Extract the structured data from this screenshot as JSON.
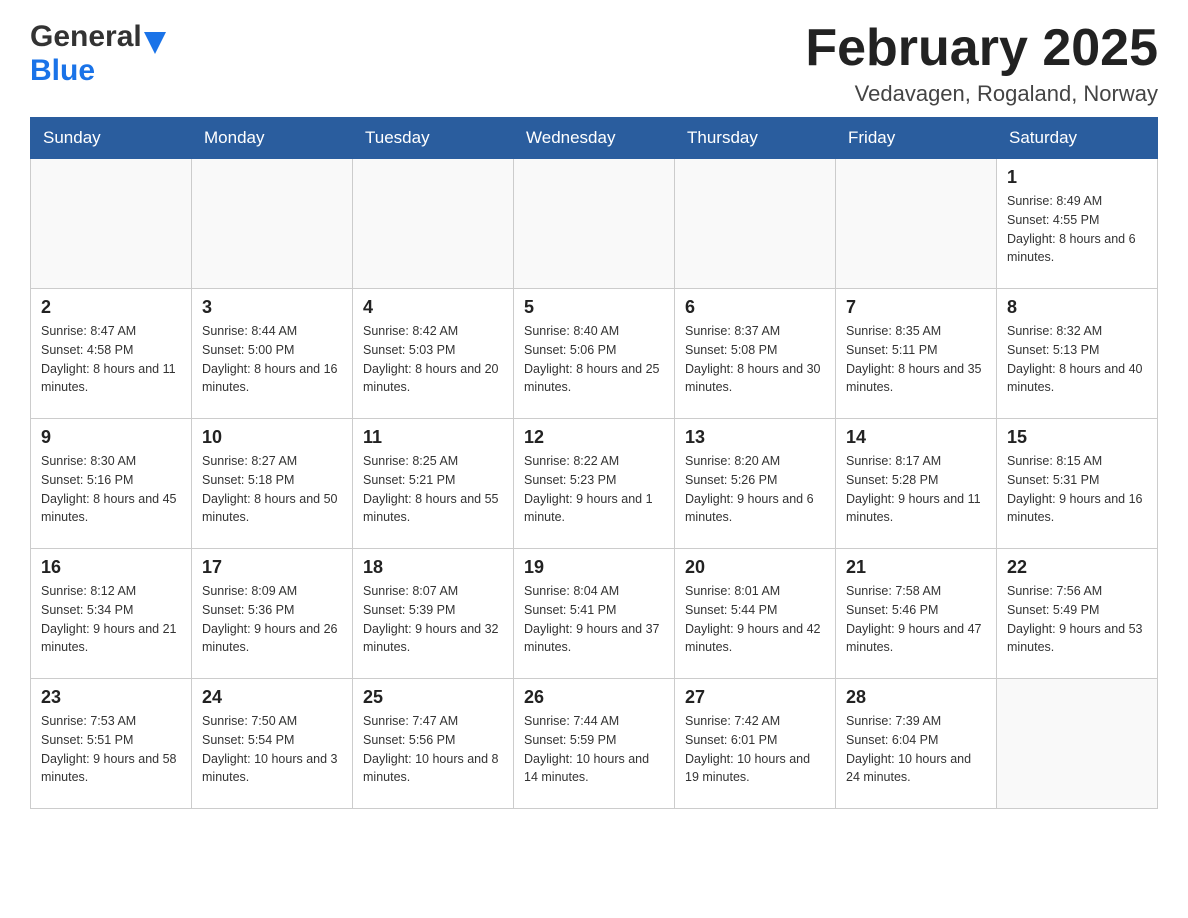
{
  "header": {
    "logo_general": "General",
    "logo_blue": "Blue",
    "month_year": "February 2025",
    "location": "Vedavagen, Rogaland, Norway"
  },
  "weekdays": [
    "Sunday",
    "Monday",
    "Tuesday",
    "Wednesday",
    "Thursday",
    "Friday",
    "Saturday"
  ],
  "weeks": [
    [
      {
        "day": "",
        "info": ""
      },
      {
        "day": "",
        "info": ""
      },
      {
        "day": "",
        "info": ""
      },
      {
        "day": "",
        "info": ""
      },
      {
        "day": "",
        "info": ""
      },
      {
        "day": "",
        "info": ""
      },
      {
        "day": "1",
        "info": "Sunrise: 8:49 AM\nSunset: 4:55 PM\nDaylight: 8 hours and 6 minutes."
      }
    ],
    [
      {
        "day": "2",
        "info": "Sunrise: 8:47 AM\nSunset: 4:58 PM\nDaylight: 8 hours and 11 minutes."
      },
      {
        "day": "3",
        "info": "Sunrise: 8:44 AM\nSunset: 5:00 PM\nDaylight: 8 hours and 16 minutes."
      },
      {
        "day": "4",
        "info": "Sunrise: 8:42 AM\nSunset: 5:03 PM\nDaylight: 8 hours and 20 minutes."
      },
      {
        "day": "5",
        "info": "Sunrise: 8:40 AM\nSunset: 5:06 PM\nDaylight: 8 hours and 25 minutes."
      },
      {
        "day": "6",
        "info": "Sunrise: 8:37 AM\nSunset: 5:08 PM\nDaylight: 8 hours and 30 minutes."
      },
      {
        "day": "7",
        "info": "Sunrise: 8:35 AM\nSunset: 5:11 PM\nDaylight: 8 hours and 35 minutes."
      },
      {
        "day": "8",
        "info": "Sunrise: 8:32 AM\nSunset: 5:13 PM\nDaylight: 8 hours and 40 minutes."
      }
    ],
    [
      {
        "day": "9",
        "info": "Sunrise: 8:30 AM\nSunset: 5:16 PM\nDaylight: 8 hours and 45 minutes."
      },
      {
        "day": "10",
        "info": "Sunrise: 8:27 AM\nSunset: 5:18 PM\nDaylight: 8 hours and 50 minutes."
      },
      {
        "day": "11",
        "info": "Sunrise: 8:25 AM\nSunset: 5:21 PM\nDaylight: 8 hours and 55 minutes."
      },
      {
        "day": "12",
        "info": "Sunrise: 8:22 AM\nSunset: 5:23 PM\nDaylight: 9 hours and 1 minute."
      },
      {
        "day": "13",
        "info": "Sunrise: 8:20 AM\nSunset: 5:26 PM\nDaylight: 9 hours and 6 minutes."
      },
      {
        "day": "14",
        "info": "Sunrise: 8:17 AM\nSunset: 5:28 PM\nDaylight: 9 hours and 11 minutes."
      },
      {
        "day": "15",
        "info": "Sunrise: 8:15 AM\nSunset: 5:31 PM\nDaylight: 9 hours and 16 minutes."
      }
    ],
    [
      {
        "day": "16",
        "info": "Sunrise: 8:12 AM\nSunset: 5:34 PM\nDaylight: 9 hours and 21 minutes."
      },
      {
        "day": "17",
        "info": "Sunrise: 8:09 AM\nSunset: 5:36 PM\nDaylight: 9 hours and 26 minutes."
      },
      {
        "day": "18",
        "info": "Sunrise: 8:07 AM\nSunset: 5:39 PM\nDaylight: 9 hours and 32 minutes."
      },
      {
        "day": "19",
        "info": "Sunrise: 8:04 AM\nSunset: 5:41 PM\nDaylight: 9 hours and 37 minutes."
      },
      {
        "day": "20",
        "info": "Sunrise: 8:01 AM\nSunset: 5:44 PM\nDaylight: 9 hours and 42 minutes."
      },
      {
        "day": "21",
        "info": "Sunrise: 7:58 AM\nSunset: 5:46 PM\nDaylight: 9 hours and 47 minutes."
      },
      {
        "day": "22",
        "info": "Sunrise: 7:56 AM\nSunset: 5:49 PM\nDaylight: 9 hours and 53 minutes."
      }
    ],
    [
      {
        "day": "23",
        "info": "Sunrise: 7:53 AM\nSunset: 5:51 PM\nDaylight: 9 hours and 58 minutes."
      },
      {
        "day": "24",
        "info": "Sunrise: 7:50 AM\nSunset: 5:54 PM\nDaylight: 10 hours and 3 minutes."
      },
      {
        "day": "25",
        "info": "Sunrise: 7:47 AM\nSunset: 5:56 PM\nDaylight: 10 hours and 8 minutes."
      },
      {
        "day": "26",
        "info": "Sunrise: 7:44 AM\nSunset: 5:59 PM\nDaylight: 10 hours and 14 minutes."
      },
      {
        "day": "27",
        "info": "Sunrise: 7:42 AM\nSunset: 6:01 PM\nDaylight: 10 hours and 19 minutes."
      },
      {
        "day": "28",
        "info": "Sunrise: 7:39 AM\nSunset: 6:04 PM\nDaylight: 10 hours and 24 minutes."
      },
      {
        "day": "",
        "info": ""
      }
    ]
  ]
}
